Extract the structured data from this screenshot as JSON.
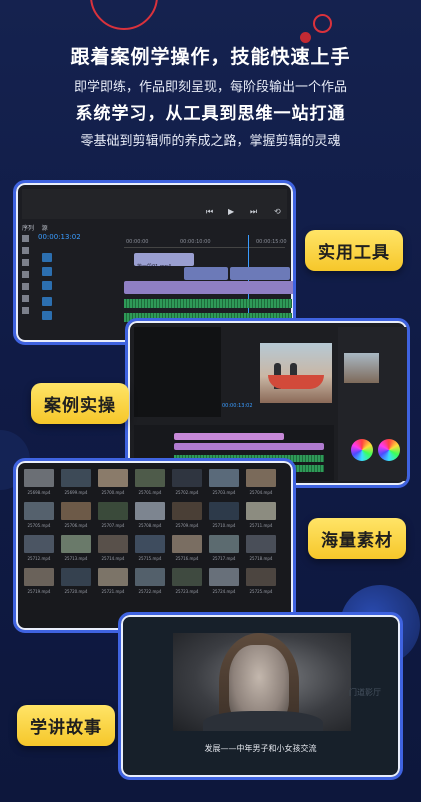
{
  "header": {
    "line1": "跟着案例学操作，技能快速上手",
    "line2": "即学即练，作品即刻呈现，每阶段输出一个作品",
    "line3": "系统学习，从工具到思维一站打通",
    "line4": "零基础到剪辑师的养成之路，掌握剪辑的灵魂"
  },
  "tags": {
    "tools": "实用工具",
    "cases": "案例实操",
    "materials": "海量素材",
    "story": "学讲故事"
  },
  "editor": {
    "tab_sequence": "序列",
    "tab_other": "源",
    "timecode": "00:00:13:02",
    "ruler": [
      "00:00:00",
      "00:00:10:00",
      "00:00:15:00"
    ],
    "clip_label": "第一段01.mp4"
  },
  "grading": {
    "timecode": "00:00:13:02"
  },
  "library": {
    "captions": [
      "25698.mp4",
      "25699.mp4",
      "25700.mp4",
      "25701.mp4",
      "25702.mp4",
      "25703.mp4",
      "25704.mp4",
      "25705.mp4",
      "25706.mp4",
      "25707.mp4",
      "25708.mp4",
      "25709.mp4",
      "25710.mp4",
      "25711.mp4",
      "25712.mp4",
      "25713.mp4",
      "25714.mp4",
      "25715.mp4",
      "25716.mp4",
      "25717.mp4",
      "25718.mp4",
      "25719.mp4",
      "25720.mp4",
      "25721.mp4",
      "25722.mp4",
      "25723.mp4",
      "25724.mp4",
      "25725.mp4"
    ],
    "thumb_colors": [
      "#6b6f75",
      "#3d4a57",
      "#8a7b6a",
      "#4e5b4a",
      "#2f3540",
      "#5a6a7a",
      "#7a6a5a",
      "#55616d",
      "#6d5a48",
      "#3a4a3a",
      "#7d8590",
      "#4a3f36",
      "#2d3a4a",
      "#8c8c80",
      "#4b5563",
      "#6a7a6a",
      "#58504a",
      "#3e4c5e",
      "#7a6e62",
      "#5c6b70",
      "#494e58",
      "#6a625a",
      "#35414f",
      "#7c7468",
      "#53606b",
      "#3f4a40",
      "#68707a",
      "#4c4540"
    ]
  },
  "story": {
    "subtitle": "发展——中年男子和小女孩交流",
    "watermark": "门道影厅"
  }
}
